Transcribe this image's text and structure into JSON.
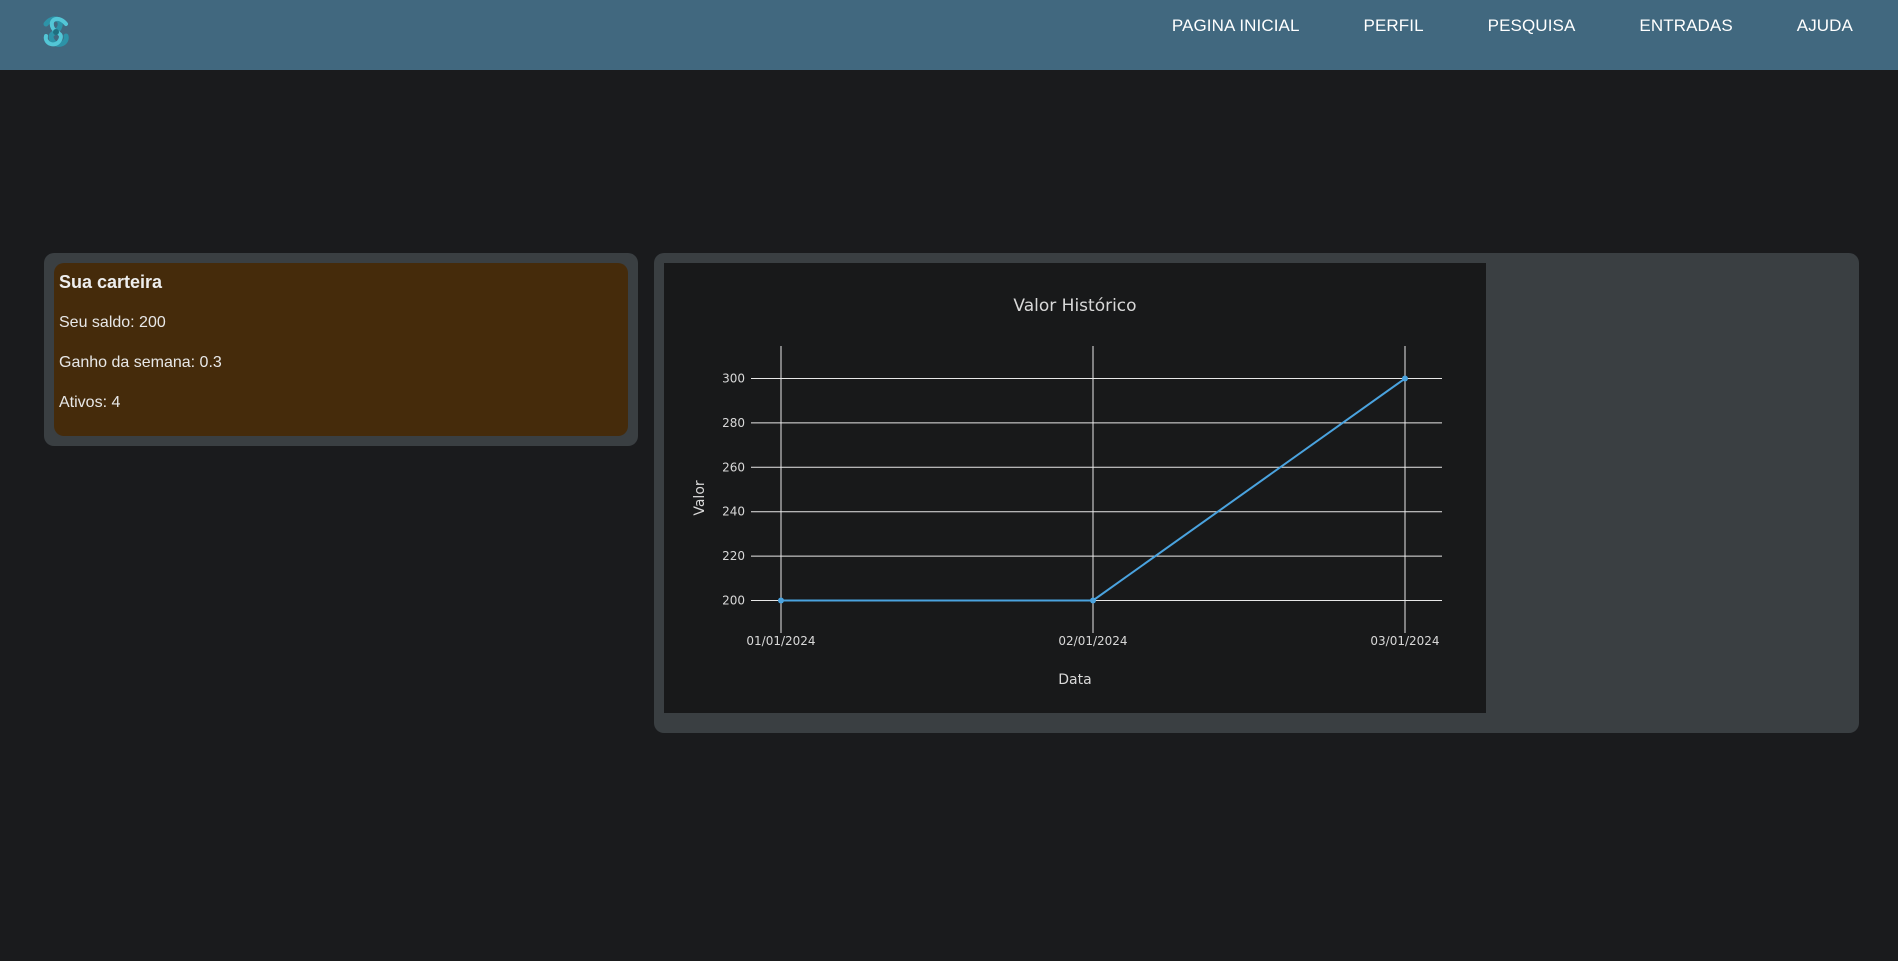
{
  "nav": {
    "items": [
      "PAGINA INICIAL",
      "PERFIL",
      "PESQUISA",
      "ENTRADAS",
      "AJUDA"
    ]
  },
  "logo": {
    "icon": "knot-logo-icon",
    "color": "#3fb5c9"
  },
  "wallet": {
    "title": "Sua carteira",
    "balance_line": "Seu saldo: 200",
    "weekly_gain_line": "Ganho da semana: 0.3",
    "assets_line": "Ativos: 4"
  },
  "colors": {
    "topbar": "#41687f",
    "background": "#1a1b1d",
    "panel": "#3a3f42",
    "wallet_card": "#452b0b",
    "series": "#4aa3df"
  },
  "chart_data": {
    "type": "line",
    "title": "Valor Histórico",
    "xlabel": "Data",
    "ylabel": "Valor",
    "x": [
      "01/01/2024",
      "02/01/2024",
      "03/01/2024"
    ],
    "series": [
      {
        "values": [
          200,
          200,
          300
        ]
      }
    ],
    "yticks": [
      200,
      220,
      240,
      260,
      280,
      300
    ],
    "ylim": [
      193,
      307
    ],
    "grid": true
  }
}
